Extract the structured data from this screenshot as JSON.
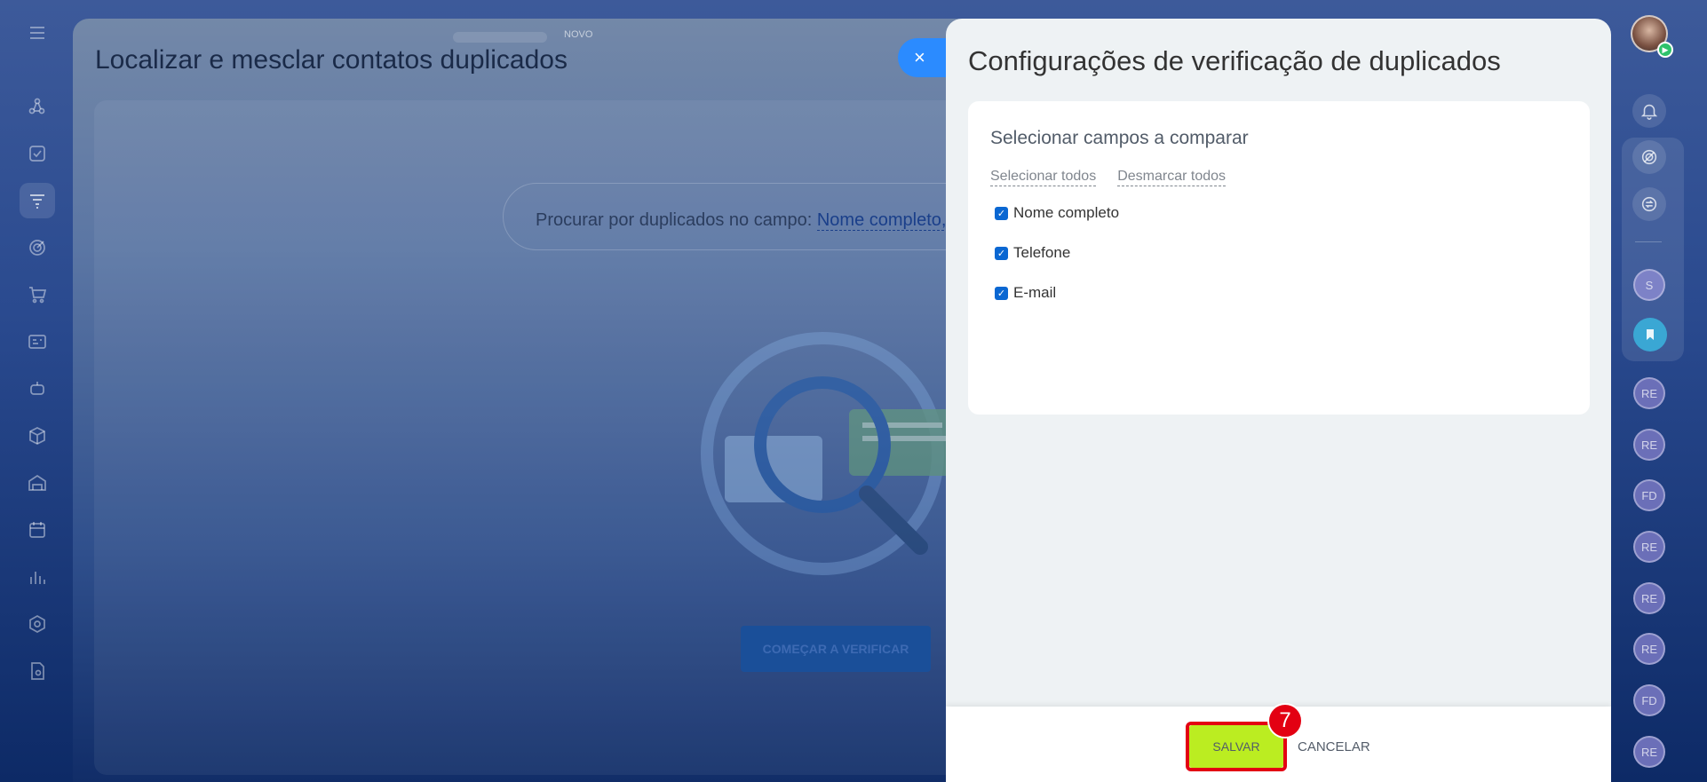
{
  "background_page": {
    "title": "Localizar e mesclar contatos duplicados",
    "search_prefix": "Procurar por duplicados no campo:",
    "search_link": "Nome completo, T",
    "start_button": "COMEÇAR A VERIFICAR",
    "top_label": "NOVO"
  },
  "close_button": {
    "label": "×"
  },
  "panel": {
    "title": "Configurações de verificação de duplicados",
    "card": {
      "heading": "Selecionar campos a comparar",
      "select_all": "Selecionar todos",
      "deselect_all": "Desmarcar todos",
      "fields": [
        {
          "label": "Nome completo",
          "checked": true
        },
        {
          "label": "Telefone",
          "checked": true
        },
        {
          "label": "E-mail",
          "checked": true
        }
      ]
    },
    "footer": {
      "save": "SALVAR",
      "cancel": "CANCELAR",
      "step_badge": "7"
    }
  },
  "right_rail": {
    "contacts": [
      "S",
      "RE",
      "RE",
      "FD",
      "RE",
      "RE",
      "RE",
      "FD",
      "RE"
    ]
  },
  "colors": {
    "save_green": "#bbed21",
    "highlight_red": "#e30012",
    "close_blue": "#2b8bff",
    "checkbox_blue": "#0a67d2"
  }
}
